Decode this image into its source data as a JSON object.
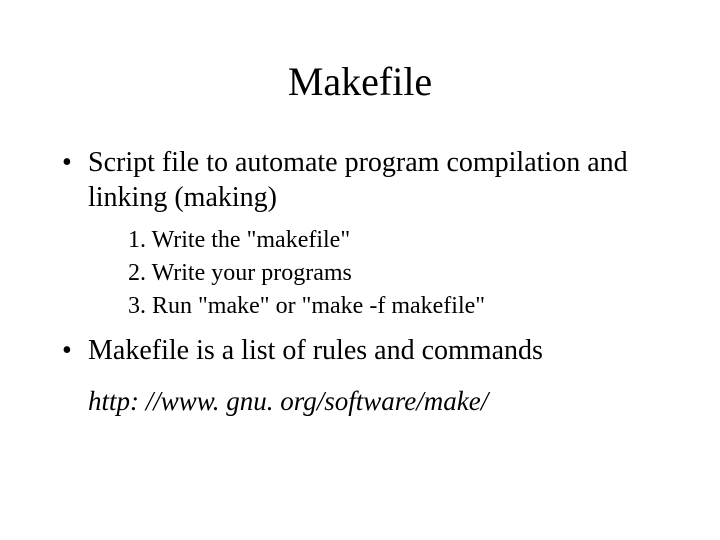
{
  "title": "Makefile",
  "bullets": [
    {
      "text": "Script file to automate program compilation and linking (making)",
      "sub": [
        "Write the \"makefile\"",
        "Write your programs",
        "Run \"make\" or \"make -f makefile\""
      ]
    },
    {
      "text": "Makefile is a list of rules and commands",
      "sub": []
    }
  ],
  "link": "http: //www. gnu. org/software/make/"
}
